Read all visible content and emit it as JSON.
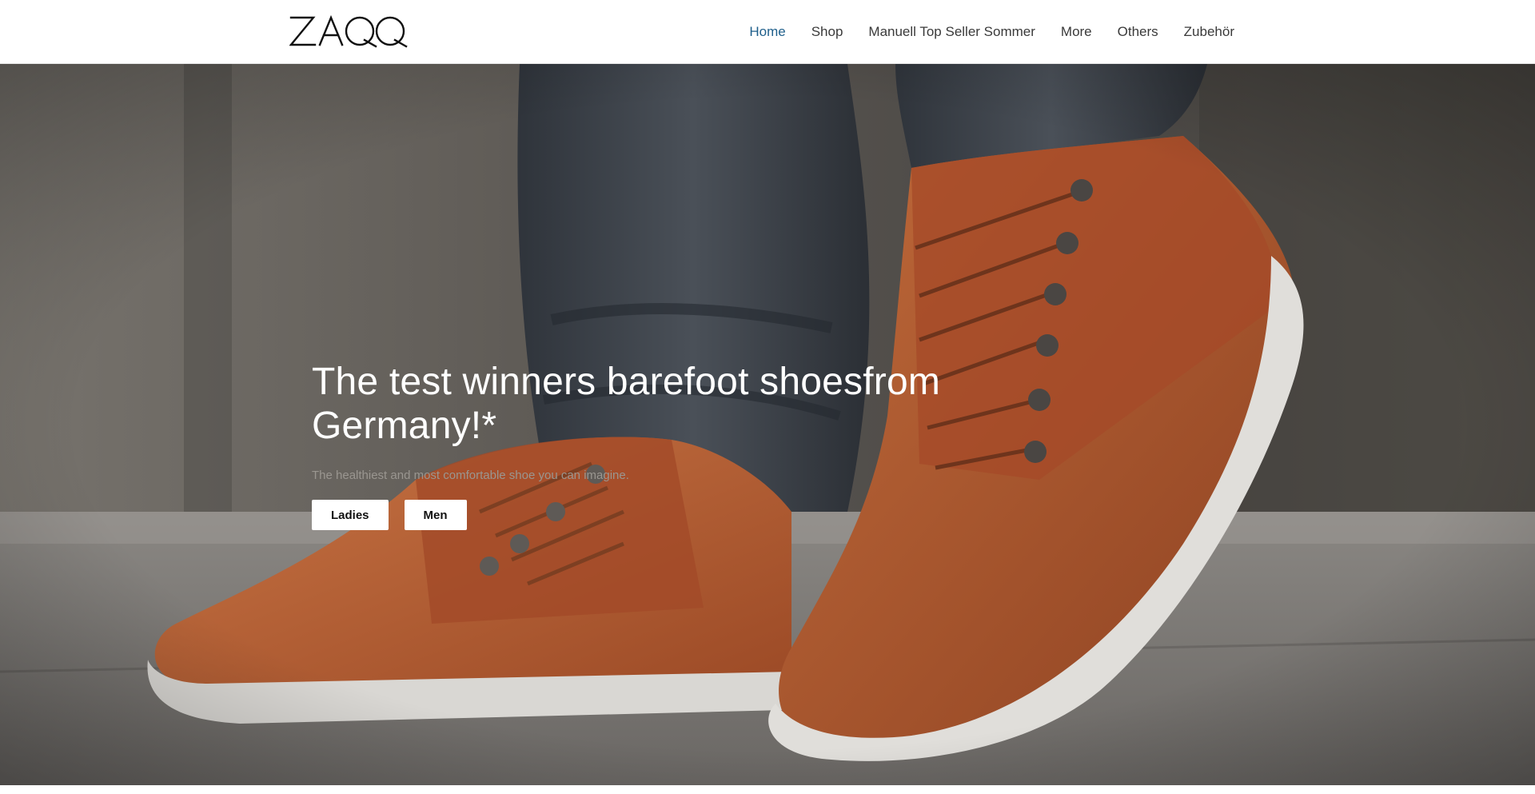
{
  "header": {
    "logo_text": "ZAQQ",
    "nav": [
      {
        "label": "Home",
        "active": true
      },
      {
        "label": "Shop",
        "active": false
      },
      {
        "label": "Manuell Top Seller Sommer",
        "active": false
      },
      {
        "label": "More",
        "active": false
      },
      {
        "label": "Others",
        "active": false
      },
      {
        "label": "Zubehör",
        "active": false
      }
    ]
  },
  "hero": {
    "title": "The test winners barefoot shoesfrom Germany!*",
    "subtitle": "The healthiest and most comfortable shoe you can imagine.",
    "buttons": [
      {
        "label": "Ladies"
      },
      {
        "label": "Men"
      }
    ],
    "image_subject": "brown-leather-barefoot-sneakers-photo"
  },
  "colors": {
    "nav_active": "#1f5f8b",
    "nav_text": "#3a3a3a",
    "leather": "#b85f32",
    "suede": "#a6492a",
    "sole": "#d9d7d3",
    "denim": "#3c4148"
  }
}
